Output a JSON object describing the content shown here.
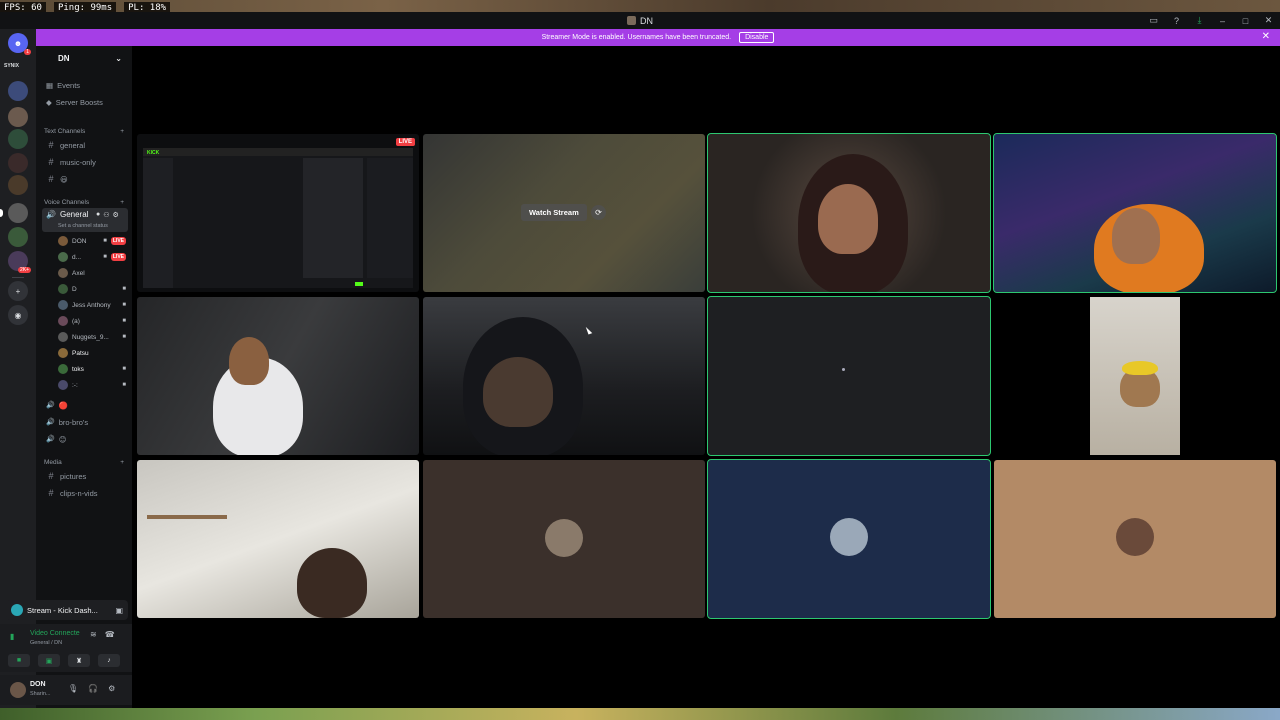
{
  "overlay": {
    "fps": "FPS: 60",
    "ping": "Ping: 99ms",
    "pl": "PL: 18%"
  },
  "window": {
    "title": "DN"
  },
  "banner": {
    "message": "Streamer Mode is enabled. Usernames have been truncated.",
    "disable_label": "Disable"
  },
  "rail": {
    "brand": "SYNIX",
    "badge_a": "1",
    "badge_b": "2K+"
  },
  "sidebar": {
    "server_name": "DN",
    "events": "Events",
    "boosts": "Server Boosts",
    "text_category": "Text Channels",
    "text_channels": [
      "general",
      "music-only",
      "😃"
    ],
    "voice_category": "Voice Channels",
    "voice_channel": "General",
    "voice_status": "Set a channel status",
    "members": [
      {
        "name": "DON",
        "live": "LIVE"
      },
      {
        "name": "d...",
        "live": "LIVE"
      },
      {
        "name": "Axel",
        "live": ""
      },
      {
        "name": "D",
        "live": ""
      },
      {
        "name": "Jess Anthony",
        "live": ""
      },
      {
        "name": "(a)",
        "live": ""
      },
      {
        "name": "Nuggets_9...",
        "live": ""
      },
      {
        "name": "Patsu",
        "live": ""
      },
      {
        "name": "toks",
        "live": ""
      },
      {
        "name": ":-:",
        "live": ""
      }
    ],
    "voice_channels_more": [
      "🔴",
      "bro-bro's",
      "😊"
    ],
    "media_category": "Media",
    "media_channels": [
      "pictures",
      "clips-n-vids"
    ]
  },
  "stream_panel": {
    "label": "Stream - Kick Dash..."
  },
  "voice_panel": {
    "title": "Video Connecte",
    "subtitle": "General / DN"
  },
  "user_panel": {
    "name": "DON",
    "subtitle": "Sharin..."
  },
  "grid": {
    "live_tag": "LIVE",
    "kick_logo": "KICK",
    "watch_stream": "Watch Stream"
  },
  "colors": {
    "accent": "#a53ee6",
    "speaking": "#2dc770",
    "live": "#f23f43",
    "kick": "#53fc18"
  }
}
